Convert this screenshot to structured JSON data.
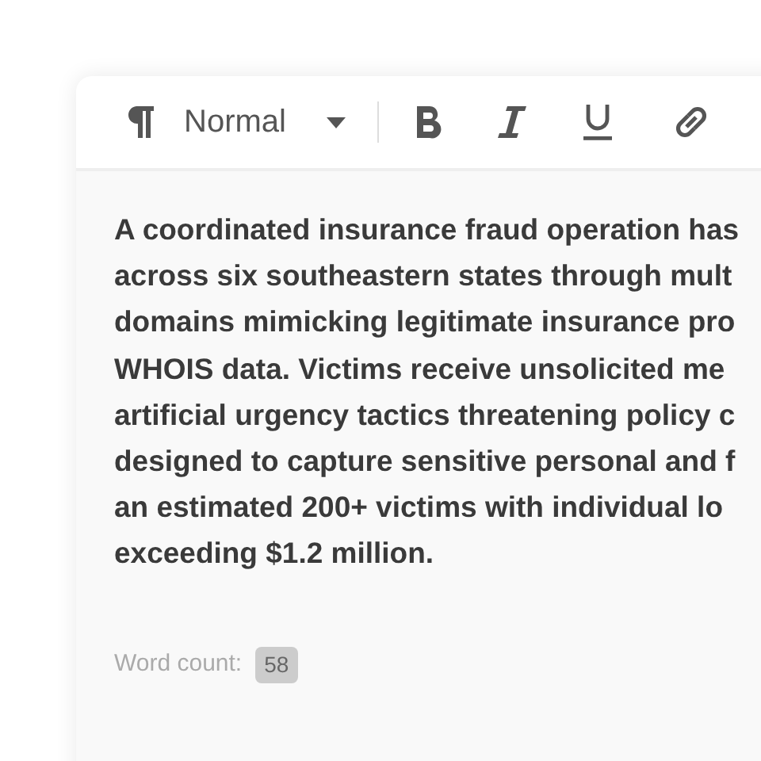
{
  "toolbar": {
    "paragraph_style": "Normal",
    "buttons": [
      {
        "kind": "bold"
      },
      {
        "kind": "italic"
      },
      {
        "kind": "underline"
      },
      {
        "kind": "link"
      }
    ]
  },
  "body_lines": [
    "A coordinated insurance fraud operation has",
    "across six southeastern states through mult",
    "domains mimicking legitimate insurance pro",
    "WHOIS data. Victims receive unsolicited me",
    "artificial urgency tactics threatening policy c",
    "designed to capture sensitive personal and f",
    "an estimated 200+ victims with individual lo",
    "exceeding $1.2 million."
  ],
  "word_count": {
    "label": "Word count:",
    "value": "58"
  }
}
